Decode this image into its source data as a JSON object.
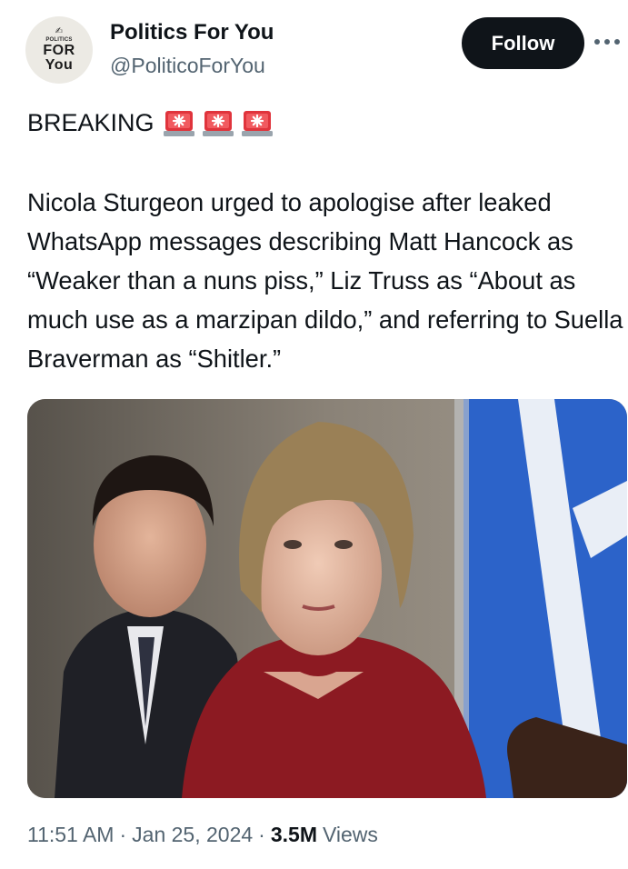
{
  "account": {
    "avatar_text_small": "POLITICS",
    "avatar_text_big_1": "FOR",
    "avatar_text_big_2": "You",
    "display_name": "Politics For You",
    "handle": "@PoliticoForYou"
  },
  "actions": {
    "follow_label": "Follow",
    "more_icon": "more-horizontal-icon"
  },
  "post": {
    "breaking_label": "BREAKING",
    "emoji": [
      "police-light-icon",
      "police-light-icon",
      "police-light-icon"
    ],
    "text": "Nicola Sturgeon urged to apologise after leaked WhatsApp messages describing Matt Hancock as “Weaker than a nuns piss,” Liz Truss as “About as much use as a marzipan dildo,” and referring to Suella Braverman as “Shitler.”"
  },
  "meta": {
    "time": "11:51 AM",
    "separator": "·",
    "date": "Jan 25, 2024",
    "views_count": "3.5M",
    "views_label": "Views"
  },
  "colors": {
    "text_primary": "#0f1419",
    "text_secondary": "#536471",
    "follow_bg": "#0f1419",
    "siren_red": "#e0343c"
  }
}
